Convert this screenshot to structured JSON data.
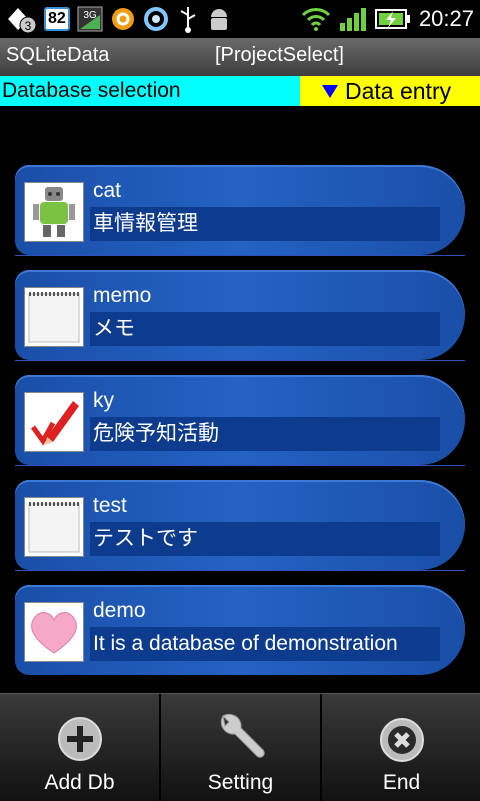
{
  "status_bar": {
    "notification_count": "3",
    "battery_badge": "82",
    "network": "3G",
    "time": "20:27",
    "icons": [
      "notification-icon",
      "battery-level-icon",
      "3g-signal-icon",
      "orange-app-icon",
      "sync-icon",
      "usb-icon",
      "android-debug-icon",
      "wifi-icon",
      "cell-signal-icon",
      "battery-charging-icon"
    ]
  },
  "title_bar": {
    "app_name": "SQLiteData",
    "screen_name": "[ProjectSelect]"
  },
  "mode_bar": {
    "database_selection": "Database selection",
    "data_entry": "Data entry",
    "colors": {
      "database_selection_bg": "#00ffff",
      "data_entry_bg": "#ffff00",
      "triangle": "#0000ff"
    }
  },
  "databases": [
    {
      "name": "cat",
      "description": "車情報管理",
      "icon": "robot-icon"
    },
    {
      "name": "memo",
      "description": "メモ",
      "icon": "notepad-icon"
    },
    {
      "name": "ky",
      "description": "危険予知活動",
      "icon": "pencil-check-icon"
    },
    {
      "name": "test",
      "description": "テストです",
      "icon": "notepad-icon"
    },
    {
      "name": "demo",
      "description": "It is a database of demonstration",
      "icon": "heart-icon"
    }
  ],
  "bottom_bar": {
    "add_db": "Add Db",
    "setting": "Setting",
    "end": "End"
  },
  "colors": {
    "item_bg": "#2462c4",
    "item_desc_bg": "#0d3c8f"
  }
}
